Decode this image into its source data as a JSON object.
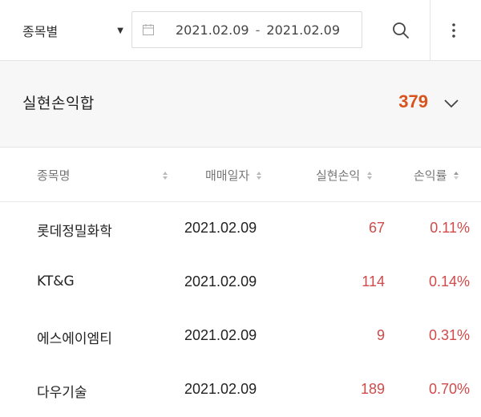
{
  "toolbar": {
    "filter_select": "종목별",
    "date_from": "2021.02.09",
    "date_to": "2021.02.09",
    "date_sep": "-"
  },
  "summary": {
    "label": "실현손익합",
    "value": "379",
    "value_color": "#d9531e"
  },
  "table": {
    "headers": [
      "종목명",
      "매매일자",
      "실현손익",
      "손익률"
    ],
    "rows": [
      {
        "name": "롯데정밀화학",
        "date": "2021.02.09",
        "pnl": "67",
        "rate": "0.11%"
      },
      {
        "name": "KT&G",
        "date": "2021.02.09",
        "pnl": "114",
        "rate": "0.14%"
      },
      {
        "name": "에스에이엠티",
        "date": "2021.02.09",
        "pnl": "9",
        "rate": "0.31%"
      },
      {
        "name": "다우기술",
        "date": "2021.02.09",
        "pnl": "189",
        "rate": "0.70%"
      }
    ],
    "positive_color": "#d04a4a"
  },
  "icons": [
    "caret-down-icon",
    "calendar-icon",
    "search-icon",
    "more-vertical-icon",
    "chevron-down-icon",
    "sort-icon"
  ]
}
